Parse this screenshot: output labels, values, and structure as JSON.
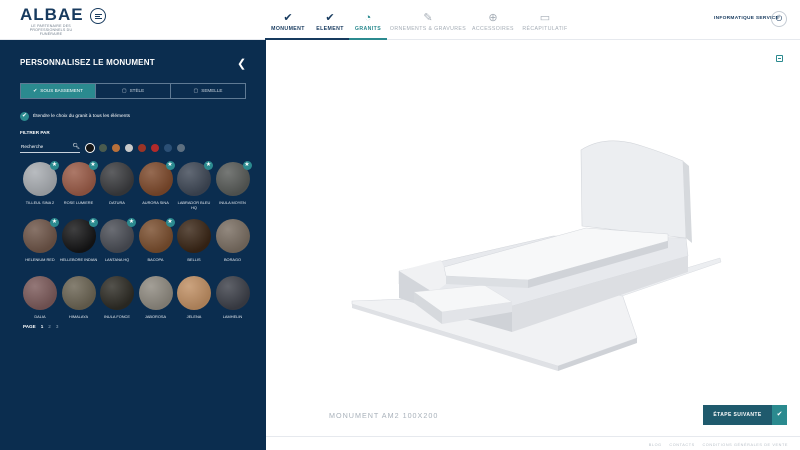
{
  "header": {
    "logo": "ALBAE",
    "tagline": "LE PARTENAIRE DES PROFESSIONNELS DU FUNÉRAIRE",
    "steps": [
      {
        "label": "MONUMENT",
        "icon": "check-icon",
        "state": "done"
      },
      {
        "label": "ELEMENT",
        "icon": "check-icon",
        "state": "done"
      },
      {
        "label": "GRANITS",
        "icon": "granit-icon",
        "state": "active"
      },
      {
        "label": "ORNEMENTS & GRAVURES",
        "icon": "pencil-icon",
        "state": "todo"
      },
      {
        "label": "ACCESSOIRES",
        "icon": "plus-circle-icon",
        "state": "todo"
      },
      {
        "label": "RÉCAPITULATIF",
        "icon": "folder-icon",
        "state": "todo"
      }
    ],
    "service": "INFORMATIQUE SERVICE",
    "power_icon": "power-icon"
  },
  "sidebar": {
    "title": "PERSONNALISEZ LE MONUMENT",
    "tabs": [
      {
        "label": "SOUS BASSEMENT",
        "active": true
      },
      {
        "label": "STÈLE",
        "active": false
      },
      {
        "label": "SEMELLE",
        "active": false
      }
    ],
    "extend_label": "Étendre le choix du granit à tous les éléments",
    "filter_label": "FILTRER PAR",
    "search_placeholder": "Recherche",
    "color_filters": [
      "#151515",
      "#4a5b4e",
      "#b8703a",
      "#c9c9c9",
      "#9b3426",
      "#b22a2a",
      "#2b4f75",
      "#5d6f80"
    ],
    "granites": [
      {
        "label": "TILLEUL SINA 2",
        "color": "#a9adb2",
        "star": true
      },
      {
        "label": "ROSE LUMIERE",
        "color": "#9a5b47",
        "star": true
      },
      {
        "label": "DATURA",
        "color": "#3b3c3f",
        "star": false
      },
      {
        "label": "AURORA SINA",
        "color": "#7e4a2c",
        "star": true
      },
      {
        "label": "LABRADOR BLEU HQ",
        "color": "#3f4856",
        "star": true
      },
      {
        "label": "INULA MOYEN",
        "color": "#585b58",
        "star": true
      },
      {
        "label": "HELENIUM RED",
        "color": "#6e5548",
        "star": true
      },
      {
        "label": "HELLEBORE INDIAN",
        "color": "#151516",
        "star": true
      },
      {
        "label": "LANTANA HQ",
        "color": "#4a4d55",
        "star": true
      },
      {
        "label": "BACOPA",
        "color": "#7a4e2e",
        "star": true
      },
      {
        "label": "BELLIS",
        "color": "#3a2616",
        "star": false
      },
      {
        "label": "BORAGO",
        "color": "#7a6e62",
        "star": false
      },
      {
        "label": "DALIA",
        "color": "#7c5a5a",
        "star": false
      },
      {
        "label": "HIMALAYA",
        "color": "#6b6453",
        "star": false
      },
      {
        "label": "INULA FONCE",
        "color": "#2e2c25",
        "star": false
      },
      {
        "label": "JABOROSA",
        "color": "#8f8a80",
        "star": false
      },
      {
        "label": "JELENA",
        "color": "#c08f63",
        "star": false
      },
      {
        "label": "LAMHELIN",
        "color": "#3d4049",
        "star": false
      }
    ],
    "pager": {
      "label": "PAGE",
      "pages": [
        "1",
        "2",
        "3"
      ],
      "current": "1"
    }
  },
  "main": {
    "monument_name": "MONUMENT AM2 100X200",
    "next_label": "ÉTAPE SUIVANTE",
    "footer_links": [
      "BLOG",
      "CONTACTS",
      "CONDITIONS GÉNÉRALES DE VENTE"
    ]
  },
  "colors": {
    "navy": "#0b2d4f",
    "teal": "#2b8a8f",
    "dark_teal": "#1f5a6d"
  }
}
